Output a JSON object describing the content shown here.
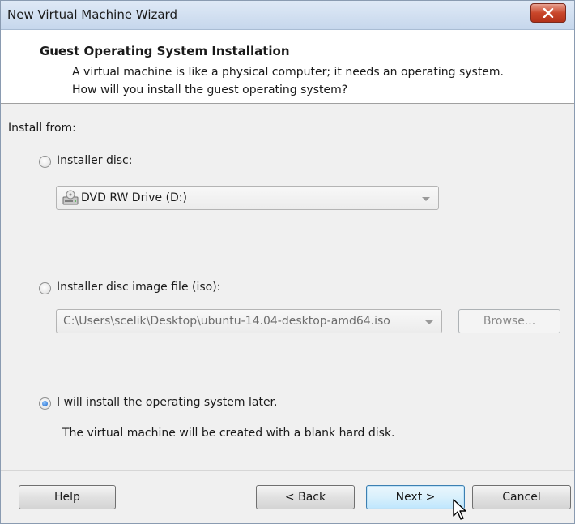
{
  "window": {
    "title": "New Virtual Machine Wizard"
  },
  "header": {
    "title": "Guest Operating System Installation",
    "description": "A virtual machine is like a physical computer; it needs an operating system. How will you install the guest operating system?"
  },
  "install_from_label": "Install from:",
  "options": {
    "installer_disc": {
      "label": "Installer disc:",
      "selected": false
    },
    "disc_drive": {
      "value": "DVD RW Drive (D:)",
      "icon": "dvd-drive-icon"
    },
    "iso_file": {
      "label": "Installer disc image file (iso):",
      "selected": false
    },
    "iso_path": {
      "value": "C:\\Users\\scelik\\Desktop\\ubuntu-14.04-desktop-amd64.iso"
    },
    "browse_label": "Browse...",
    "install_later": {
      "label": "I will install the operating system later.",
      "selected": true
    },
    "install_later_desc": "The virtual machine will be created with a blank hard disk."
  },
  "footer": {
    "help": "Help",
    "back": "< Back",
    "next": "Next >",
    "cancel": "Cancel"
  }
}
